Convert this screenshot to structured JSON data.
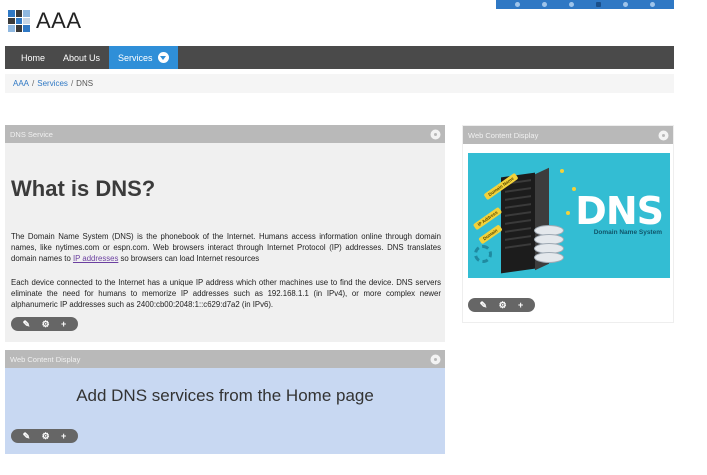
{
  "site": {
    "name": "AAA"
  },
  "nav": {
    "items": [
      {
        "label": "Home"
      },
      {
        "label": "About Us"
      },
      {
        "label": "Services"
      }
    ]
  },
  "breadcrumb": {
    "root": "AAA",
    "section": "Services",
    "current": "DNS"
  },
  "dns_service": {
    "header": "DNS Service",
    "title": "What is DNS?",
    "para1_before": "The Domain Name System (DNS) is the phonebook of the Internet. Humans access information online through domain names, like nytimes.com or espn.com. Web browsers interact through Internet Protocol (IP) addresses. DNS translates domain names to ",
    "para1_link": "IP addresses",
    "para1_after": " so browsers can load Internet resources",
    "para2": "Each device connected to the Internet has a unique IP address which other machines use to find the device. DNS servers eliminate the need for humans to memorize IP addresses such as 192.168.1.1 (in IPv4), or more complex newer alphanumeric IP addresses such as 2400:cb00:2048:1::c629:d7a2 (in IPv6)."
  },
  "web_content_1": {
    "header": "Web Content Display",
    "text": "Add DNS services from the Home page"
  },
  "web_content_2": {
    "header": "Web Content Display",
    "image_title": "DNS",
    "image_subtitle": "Domain Name System",
    "image_tags": [
      "Domain Name",
      "IP Address",
      "Domain"
    ]
  },
  "toolbar": {
    "edit": "✎",
    "settings": "⚙",
    "add": "+"
  },
  "colors": {
    "accent": "#2f8fd8",
    "navbar": "#4a4a4a",
    "portlet_header": "#b9b9b9",
    "image_bg": "#33bdd3"
  }
}
